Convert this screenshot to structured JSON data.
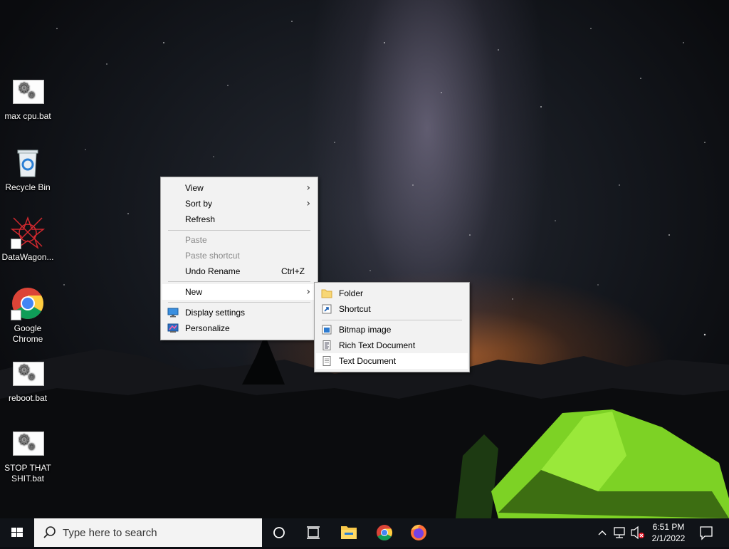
{
  "desktop": {
    "icons": [
      {
        "label": "max cpu.bat",
        "type": "bat-file"
      },
      {
        "label": "Recycle Bin",
        "type": "recycle-bin"
      },
      {
        "label": "DataWagon...",
        "type": "app-shortcut"
      },
      {
        "label": "Google Chrome",
        "line1": "Google",
        "line2": "Chrome",
        "type": "chrome-shortcut"
      },
      {
        "label": "reboot.bat",
        "type": "bat-file"
      },
      {
        "label": "STOP THAT SHIT.bat",
        "line1": "STOP THAT",
        "line2": "SHIT.bat",
        "type": "bat-file"
      }
    ]
  },
  "context_menu": {
    "items": {
      "view": {
        "label": "View",
        "submenu": true
      },
      "sort_by": {
        "label": "Sort by",
        "submenu": true
      },
      "refresh": {
        "label": "Refresh"
      },
      "paste": {
        "label": "Paste",
        "disabled": true
      },
      "paste_shortcut": {
        "label": "Paste shortcut",
        "disabled": true
      },
      "undo_rename": {
        "label": "Undo Rename",
        "shortcut": "Ctrl+Z"
      },
      "new": {
        "label": "New",
        "submenu": true,
        "highlighted": true
      },
      "display_settings": {
        "label": "Display settings",
        "icon": "display-icon"
      },
      "personalize": {
        "label": "Personalize",
        "icon": "personalize-icon"
      }
    }
  },
  "new_submenu": {
    "items": {
      "folder": {
        "label": "Folder",
        "icon": "folder-icon"
      },
      "shortcut": {
        "label": "Shortcut",
        "icon": "shortcut-icon"
      },
      "bitmap": {
        "label": "Bitmap image",
        "icon": "bitmap-icon"
      },
      "rtf": {
        "label": "Rich Text Document",
        "icon": "rich-text-icon"
      },
      "text": {
        "label": "Text Document",
        "icon": "text-document-icon",
        "highlighted": true
      }
    }
  },
  "taskbar": {
    "search_placeholder": "Type here to search",
    "pinned": [
      "cortana-icon",
      "task-view-icon",
      "file-explorer-icon",
      "chrome-icon",
      "firefox-icon"
    ],
    "tray": [
      "chevron-up-icon",
      "network-icon",
      "volume-muted-icon"
    ],
    "clock": {
      "time": "6:51 PM",
      "date": "2/1/2022"
    },
    "notification_icon": "action-center-icon"
  },
  "colors": {
    "menu_bg": "#f2f2f2",
    "menu_highlight": "#ffffff",
    "taskbar_bg": "#101318",
    "tent_green": "#8de02a"
  }
}
